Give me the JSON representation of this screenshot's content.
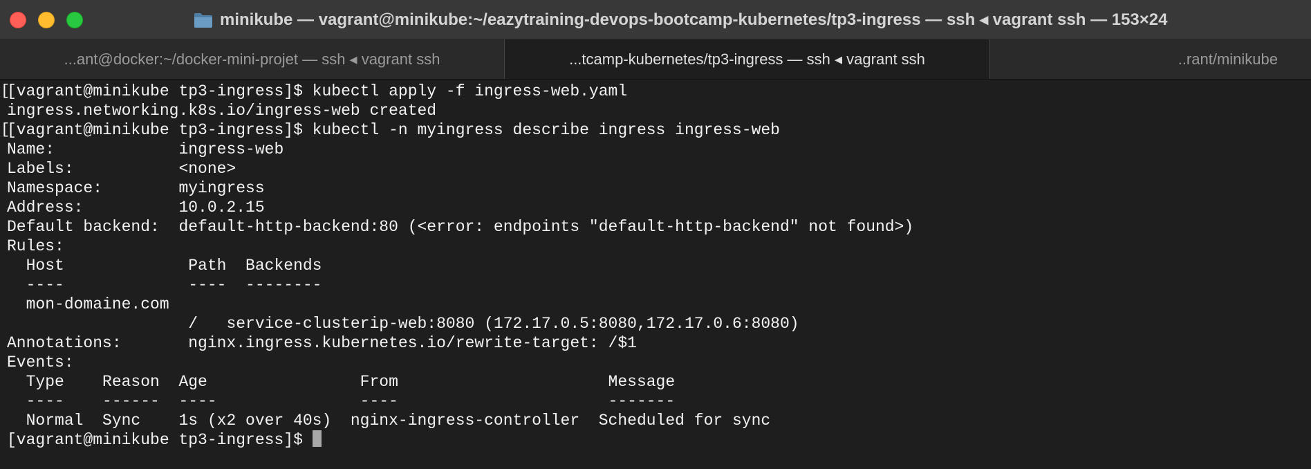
{
  "window": {
    "title": "minikube — vagrant@minikube:~/eazytraining-devops-bootcamp-kubernetes/tp3-ingress — ssh ◂ vagrant ssh — 153×24",
    "icon": "folder-icon",
    "colors": {
      "close": "#ff5f57",
      "minimize": "#febc2e",
      "zoom": "#28c840",
      "background": "#1e1e1e",
      "text": "#f2f2f2",
      "folder": "#5b8fb9"
    }
  },
  "tabs": [
    {
      "label": "...ant@docker:~/docker-mini-projet — ssh ◂ vagrant ssh",
      "active": false
    },
    {
      "label": "...tcamp-kubernetes/tp3-ingress — ssh ◂ vagrant ssh",
      "active": true
    },
    {
      "label": "..rant/minikube",
      "active": false
    }
  ],
  "terminal": {
    "lines": [
      {
        "text": "[vagrant@minikube tp3-ingress]$ kubectl apply -f ingress-web.yaml",
        "marked": true
      },
      {
        "text": "ingress.networking.k8s.io/ingress-web created",
        "marked": false
      },
      {
        "text": "[vagrant@minikube tp3-ingress]$ kubectl -n myingress describe ingress ingress-web",
        "marked": true
      },
      {
        "text": "Name:             ingress-web",
        "marked": false
      },
      {
        "text": "Labels:           <none>",
        "marked": false
      },
      {
        "text": "Namespace:        myingress",
        "marked": false
      },
      {
        "text": "Address:          10.0.2.15",
        "marked": false
      },
      {
        "text": "Default backend:  default-http-backend:80 (<error: endpoints \"default-http-backend\" not found>)",
        "marked": false
      },
      {
        "text": "Rules:",
        "marked": false
      },
      {
        "text": "  Host             Path  Backends",
        "marked": false
      },
      {
        "text": "  ----             ----  --------",
        "marked": false
      },
      {
        "text": "  mon-domaine.com",
        "marked": false
      },
      {
        "text": "                   /   service-clusterip-web:8080 (172.17.0.5:8080,172.17.0.6:8080)",
        "marked": false
      },
      {
        "text": "Annotations:       nginx.ingress.kubernetes.io/rewrite-target: /$1",
        "marked": false
      },
      {
        "text": "Events:",
        "marked": false
      },
      {
        "text": "  Type    Reason  Age                From                      Message",
        "marked": false
      },
      {
        "text": "  ----    ------  ----               ----                      -------",
        "marked": false
      },
      {
        "text": "  Normal  Sync    1s (x2 over 40s)  nginx-ingress-controller  Scheduled for sync",
        "marked": false
      }
    ],
    "prompt": "[vagrant@minikube tp3-ingress]$ ",
    "marker_glyph": "["
  }
}
